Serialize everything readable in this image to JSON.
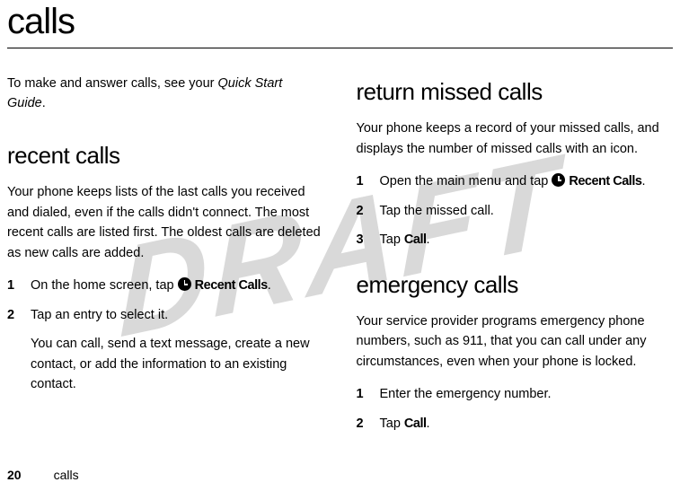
{
  "watermark": "DRAFT",
  "page_title": "calls",
  "intro_prefix": "To make and answer calls, see your ",
  "intro_italic": "Quick Start Guide",
  "intro_suffix": ".",
  "recent": {
    "heading": "recent calls",
    "para": "Your phone keeps lists of the last calls you received and dialed, even if the calls didn't connect. The most recent calls are listed first. The oldest calls are deleted as new calls are added.",
    "steps": [
      {
        "num": "1",
        "prefix": "On the home screen, tap ",
        "icon_label": "Recent Calls",
        "suffix": "."
      },
      {
        "num": "2",
        "text": "Tap an entry to select it."
      }
    ],
    "sub": "You can call, send a text message, create a new contact, or add the information to an existing contact."
  },
  "missed": {
    "heading": "return missed calls",
    "para": "Your phone keeps a record of your missed calls, and displays the number of missed calls with an icon.",
    "steps": [
      {
        "num": "1",
        "prefix": "Open the main menu and tap ",
        "icon_label": "Recent Calls",
        "suffix": "."
      },
      {
        "num": "2",
        "text": "Tap the missed call."
      },
      {
        "num": "3",
        "prefix": "Tap ",
        "bold": "Call",
        "suffix": "."
      }
    ]
  },
  "emergency": {
    "heading": "emergency calls",
    "para": "Your service provider programs emergency phone numbers, such as 911, that you can call under any circumstances, even when your phone is locked.",
    "steps": [
      {
        "num": "1",
        "text": "Enter the emergency number."
      },
      {
        "num": "2",
        "prefix": "Tap ",
        "bold": "Call",
        "suffix": "."
      }
    ]
  },
  "footer": {
    "page_num": "20",
    "section": "calls"
  }
}
